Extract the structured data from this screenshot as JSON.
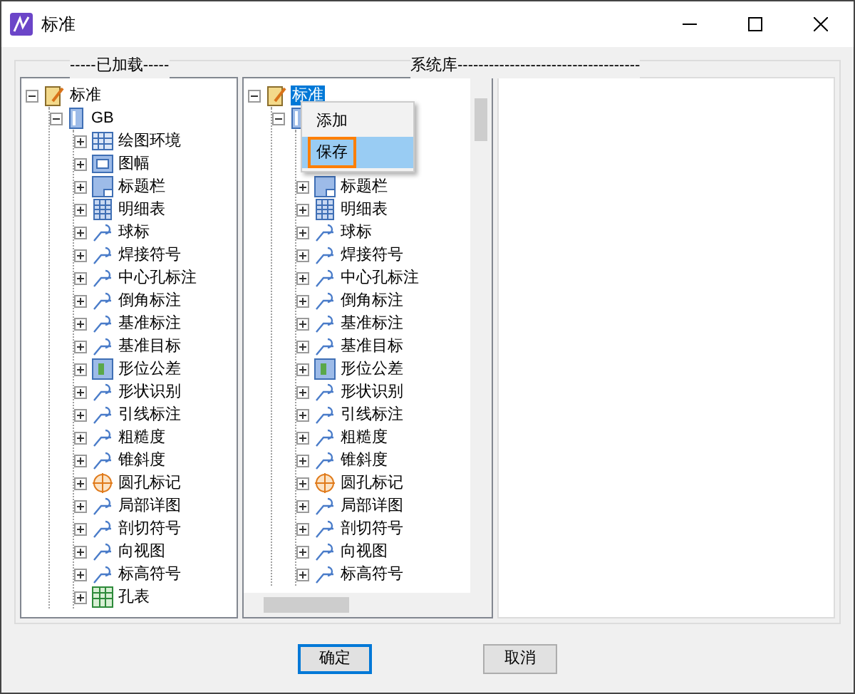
{
  "window": {
    "title": "标准"
  },
  "loaded": {
    "caption": "-----已加载-----",
    "tree": [
      {
        "label": "标准",
        "kind": "notebook",
        "expanded": true,
        "selected": false,
        "children": [
          {
            "label": "GB",
            "kind": "book",
            "expanded": true,
            "selected": false,
            "children": [
              {
                "label": "绘图环境",
                "kind": "grid",
                "expanded": false,
                "selected": false
              },
              {
                "label": "图幅",
                "kind": "frame",
                "expanded": false,
                "selected": false
              },
              {
                "label": "标题栏",
                "kind": "sheet",
                "expanded": false,
                "selected": false
              },
              {
                "label": "明细表",
                "kind": "table",
                "expanded": false,
                "selected": false
              },
              {
                "label": "球标",
                "kind": "symbol",
                "expanded": false,
                "selected": false
              },
              {
                "label": "焊接符号",
                "kind": "symbol",
                "expanded": false,
                "selected": false
              },
              {
                "label": "中心孔标注",
                "kind": "symbol",
                "expanded": false,
                "selected": false
              },
              {
                "label": "倒角标注",
                "kind": "symbol",
                "expanded": false,
                "selected": false
              },
              {
                "label": "基准标注",
                "kind": "symbol",
                "expanded": false,
                "selected": false
              },
              {
                "label": "基准目标",
                "kind": "symbol",
                "expanded": false,
                "selected": false
              },
              {
                "label": "形位公差",
                "kind": "tolerance",
                "expanded": false,
                "selected": false
              },
              {
                "label": "形状识别",
                "kind": "symbol",
                "expanded": false,
                "selected": false
              },
              {
                "label": "引线标注",
                "kind": "symbol",
                "expanded": false,
                "selected": false
              },
              {
                "label": "粗糙度",
                "kind": "symbol",
                "expanded": false,
                "selected": false
              },
              {
                "label": "锥斜度",
                "kind": "symbol",
                "expanded": false,
                "selected": false
              },
              {
                "label": "圆孔标记",
                "kind": "hole",
                "expanded": false,
                "selected": false
              },
              {
                "label": "局部详图",
                "kind": "symbol",
                "expanded": false,
                "selected": false
              },
              {
                "label": "剖切符号",
                "kind": "symbol",
                "expanded": false,
                "selected": false
              },
              {
                "label": "向视图",
                "kind": "symbol",
                "expanded": false,
                "selected": false
              },
              {
                "label": "标高符号",
                "kind": "symbol",
                "expanded": false,
                "selected": false
              },
              {
                "label": "孔表",
                "kind": "holetable",
                "expanded": false,
                "selected": false
              }
            ]
          }
        ]
      }
    ]
  },
  "library": {
    "caption": "系统库-----------------------------------",
    "tree": [
      {
        "label": "标准",
        "kind": "notebook",
        "expanded": true,
        "selected": true,
        "children": [
          {
            "kind": "book",
            "expanded": true,
            "children": [
              {
                "label": "标题栏",
                "kind": "sheet",
                "expanded": false,
                "selected": false
              },
              {
                "label": "明细表",
                "kind": "table",
                "expanded": false,
                "selected": false
              },
              {
                "label": "球标",
                "kind": "symbol",
                "expanded": false,
                "selected": false
              },
              {
                "label": "焊接符号",
                "kind": "symbol",
                "expanded": false,
                "selected": false
              },
              {
                "label": "中心孔标注",
                "kind": "symbol",
                "expanded": false,
                "selected": false
              },
              {
                "label": "倒角标注",
                "kind": "symbol",
                "expanded": false,
                "selected": false
              },
              {
                "label": "基准标注",
                "kind": "symbol",
                "expanded": false,
                "selected": false
              },
              {
                "label": "基准目标",
                "kind": "symbol",
                "expanded": false,
                "selected": false
              },
              {
                "label": "形位公差",
                "kind": "tolerance",
                "expanded": false,
                "selected": false
              },
              {
                "label": "形状识别",
                "kind": "symbol",
                "expanded": false,
                "selected": false
              },
              {
                "label": "引线标注",
                "kind": "symbol",
                "expanded": false,
                "selected": false
              },
              {
                "label": "粗糙度",
                "kind": "symbol",
                "expanded": false,
                "selected": false
              },
              {
                "label": "锥斜度",
                "kind": "symbol",
                "expanded": false,
                "selected": false
              },
              {
                "label": "圆孔标记",
                "kind": "hole",
                "expanded": false,
                "selected": false
              },
              {
                "label": "局部详图",
                "kind": "symbol",
                "expanded": false,
                "selected": false
              },
              {
                "label": "剖切符号",
                "kind": "symbol",
                "expanded": false,
                "selected": false
              },
              {
                "label": "向视图",
                "kind": "symbol",
                "expanded": false,
                "selected": false
              },
              {
                "label": "标高符号",
                "kind": "symbol",
                "expanded": false,
                "selected": false
              }
            ]
          }
        ]
      }
    ]
  },
  "context_menu": [
    {
      "label": "添加",
      "selected": false
    },
    {
      "label": "保存",
      "selected": true
    }
  ],
  "buttons": [
    {
      "label": "确定",
      "default": true
    },
    {
      "label": "取消",
      "default": false
    }
  ]
}
